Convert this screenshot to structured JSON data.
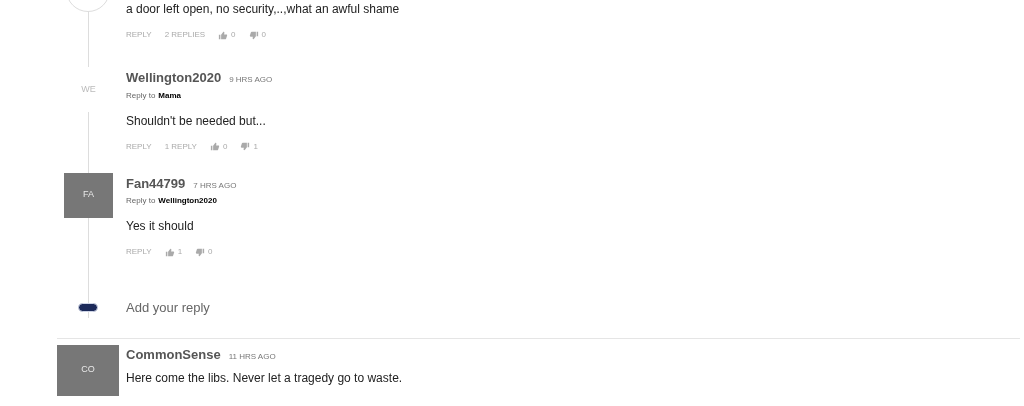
{
  "comments": [
    {
      "avatar": {
        "kind": "outline"
      },
      "text": "a door left open, no security,..,what an awful shame",
      "actions": {
        "reply": "REPLY",
        "replies": "2 REPLIES",
        "likes": "0",
        "dislikes": "0"
      },
      "replies": [
        {
          "avatar": {
            "kind": "plain",
            "initials": "WE"
          },
          "author": "Wellington2020",
          "time": "9 HRS AGO",
          "reply_to": {
            "label": "Reply to",
            "name": "Mama"
          },
          "text": "Shouldn't be needed but...",
          "actions": {
            "reply": "REPLY",
            "replies": "1 REPLY",
            "likes": "0",
            "dislikes": "1"
          }
        },
        {
          "avatar": {
            "kind": "filled",
            "initials": "FA"
          },
          "author": "Fan44799",
          "time": "7 HRS AGO",
          "reply_to": {
            "label": "Reply to",
            "name": "Wellington2020"
          },
          "text": "Yes it should",
          "actions": {
            "reply": "REPLY",
            "likes": "1",
            "dislikes": "0"
          }
        }
      ],
      "add_reply": {
        "placeholder": "Add your reply"
      }
    },
    {
      "avatar": {
        "kind": "filled",
        "initials": "CO"
      },
      "author": "CommonSense",
      "time": "11 HRS AGO",
      "text": "Here come the libs. Never let a tragedy go to waste."
    }
  ]
}
